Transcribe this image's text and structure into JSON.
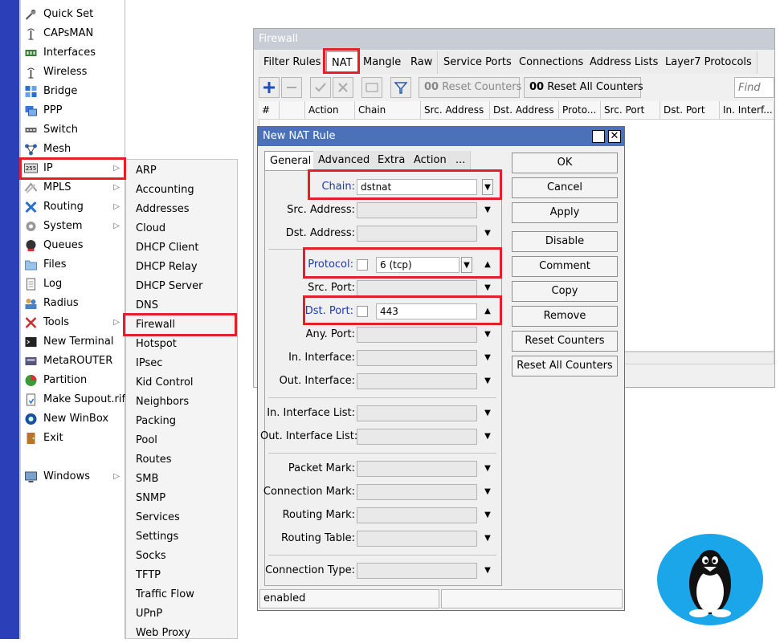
{
  "main_menu": {
    "items": [
      {
        "label": "Quick Set",
        "icon": "quick-set-icon"
      },
      {
        "label": "CAPsMAN",
        "icon": "antenna-icon"
      },
      {
        "label": "Interfaces",
        "icon": "interfaces-icon"
      },
      {
        "label": "Wireless",
        "icon": "wireless-icon"
      },
      {
        "label": "Bridge",
        "icon": "bridge-icon"
      },
      {
        "label": "PPP",
        "icon": "ppp-icon"
      },
      {
        "label": "Switch",
        "icon": "switch-icon"
      },
      {
        "label": "Mesh",
        "icon": "mesh-icon"
      },
      {
        "label": "IP",
        "icon": "ip-icon",
        "ip_badge": "255"
      },
      {
        "label": "MPLS",
        "icon": "mpls-icon"
      },
      {
        "label": "Routing",
        "icon": "routing-icon"
      },
      {
        "label": "System",
        "icon": "gear-icon"
      },
      {
        "label": "Queues",
        "icon": "queues-icon"
      },
      {
        "label": "Files",
        "icon": "folder-icon"
      },
      {
        "label": "Log",
        "icon": "log-icon"
      },
      {
        "label": "Radius",
        "icon": "radius-icon"
      },
      {
        "label": "Tools",
        "icon": "tools-icon"
      },
      {
        "label": "New Terminal",
        "icon": "terminal-icon"
      },
      {
        "label": "MetaROUTER",
        "icon": "metarouter-icon"
      },
      {
        "label": "Partition",
        "icon": "partition-icon"
      },
      {
        "label": "Make Supout.rif",
        "icon": "supout-icon"
      },
      {
        "label": "New WinBox",
        "icon": "winbox-icon"
      },
      {
        "label": "Exit",
        "icon": "exit-icon"
      },
      {
        "label": "Windows",
        "icon": "windows-icon"
      }
    ]
  },
  "ip_submenu": {
    "items": [
      "ARP",
      "Accounting",
      "Addresses",
      "Cloud",
      "DHCP Client",
      "DHCP Relay",
      "DHCP Server",
      "DNS",
      "Firewall",
      "Hotspot",
      "IPsec",
      "Kid Control",
      "Neighbors",
      "Packing",
      "Pool",
      "Routes",
      "SMB",
      "SNMP",
      "Services",
      "Settings",
      "Socks",
      "TFTP",
      "Traffic Flow",
      "UPnP",
      "Web Proxy"
    ]
  },
  "firewall": {
    "title": "Firewall",
    "tabs": [
      "Filter Rules",
      "NAT",
      "Mangle",
      "Raw",
      "Service Ports",
      "Connections",
      "Address Lists",
      "Layer7 Protocols"
    ],
    "toolbar": {
      "reset_counters": "Reset Counters",
      "reset_all_counters": "Reset All Counters",
      "counter_glyph": "00",
      "find_placeholder": "Find"
    },
    "columns": [
      "#",
      "",
      "Action",
      "Chain",
      "Src. Address",
      "Dst. Address",
      "Proto...",
      "Src. Port",
      "Dst. Port",
      "In. Interf..."
    ]
  },
  "nat_dialog": {
    "title": "New NAT Rule",
    "tabs": [
      "General",
      "Advanced",
      "Extra",
      "Action",
      "..."
    ],
    "fields": {
      "chain": {
        "label": "Chain:",
        "value": "dstnat"
      },
      "src_address": {
        "label": "Src. Address:"
      },
      "dst_address": {
        "label": "Dst. Address:"
      },
      "protocol": {
        "label": "Protocol:",
        "value": "6 (tcp)"
      },
      "src_port": {
        "label": "Src. Port:"
      },
      "dst_port": {
        "label": "Dst. Port:",
        "value": "443"
      },
      "any_port": {
        "label": "Any. Port:"
      },
      "in_interface": {
        "label": "In. Interface:"
      },
      "out_interface": {
        "label": "Out. Interface:"
      },
      "in_interface_list": {
        "label": "In. Interface List:"
      },
      "out_interface_list": {
        "label": "Out. Interface List:"
      },
      "packet_mark": {
        "label": "Packet Mark:"
      },
      "connection_mark": {
        "label": "Connection Mark:"
      },
      "routing_mark": {
        "label": "Routing Mark:"
      },
      "routing_table": {
        "label": "Routing Table:"
      },
      "connection_type": {
        "label": "Connection Type:"
      }
    },
    "buttons": [
      "OK",
      "Cancel",
      "Apply",
      "Disable",
      "Comment",
      "Copy",
      "Remove",
      "Reset Counters",
      "Reset All Counters"
    ],
    "status": "enabled"
  },
  "colors": {
    "highlight": "#e3202a",
    "strip": "#2b3fb8",
    "dialog_title": "#4b72b8",
    "field_label_active": "#1e3ab0",
    "tux_bg": "#1aa6e8"
  }
}
